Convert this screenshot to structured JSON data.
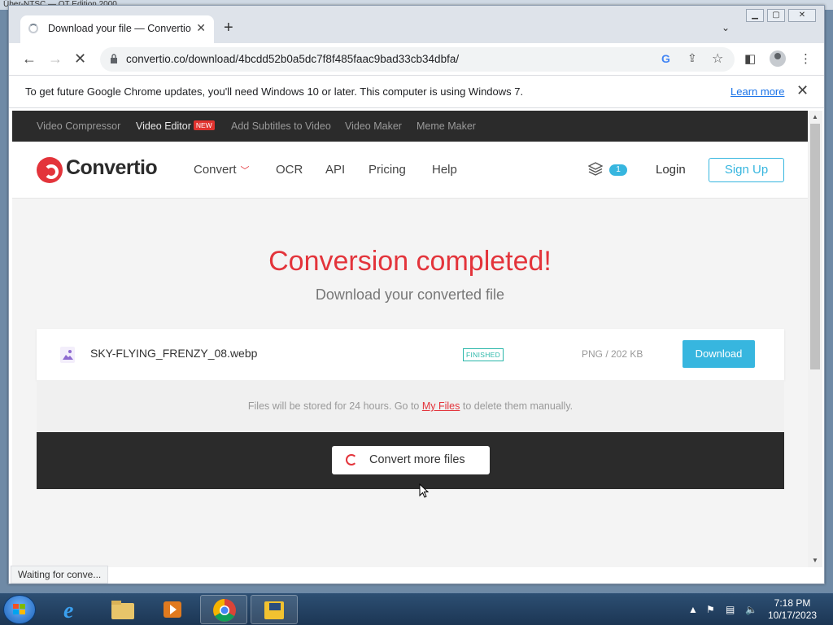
{
  "os": {
    "window_title": "Über-NTSC — QT Edition 2000"
  },
  "browser": {
    "tab_title": "Download your file — Convertio",
    "tab_close": "✕",
    "new_tab": "+",
    "tab_menu": "⌄",
    "url": "convertio.co/download/4bcdd52b0a5dc7f8f485faac9bad33cb34dbfa/",
    "infobar_message": "To get future Google Chrome updates, you'll need Windows 10 or later. This computer is using Windows 7.",
    "infobar_link": "Learn more",
    "status_text": "Waiting for conve..."
  },
  "site": {
    "topbar": {
      "items": [
        "Video Compressor",
        "Video Editor",
        "Add Subtitles to Video",
        "Video Maker",
        "Meme Maker"
      ],
      "new_badge": "NEW"
    },
    "brand": "Convertio",
    "nav": {
      "convert": "Convert",
      "ocr": "OCR",
      "api": "API",
      "pricing": "Pricing",
      "help": "Help"
    },
    "files_count": "1",
    "login": "Login",
    "signup": "Sign Up"
  },
  "main": {
    "headline": "Conversion completed!",
    "subhead": "Download your converted file",
    "file": {
      "name": "SKY-FLYING_FRENZY_08.webp",
      "status": "FINISHED",
      "info": "PNG / 202 KB",
      "download_label": "Download"
    },
    "storage_note_before": "Files will be stored for 24 hours. Go to ",
    "storage_note_link": "My Files",
    "storage_note_after": " to delete them manually.",
    "convert_more_label": "Convert more files"
  },
  "taskbar": {
    "time": "7:18 PM",
    "date": "10/17/2023"
  },
  "colors": {
    "accent_red": "#e3343b",
    "accent_blue": "#37b6df",
    "status_teal": "#2ab7a9"
  }
}
